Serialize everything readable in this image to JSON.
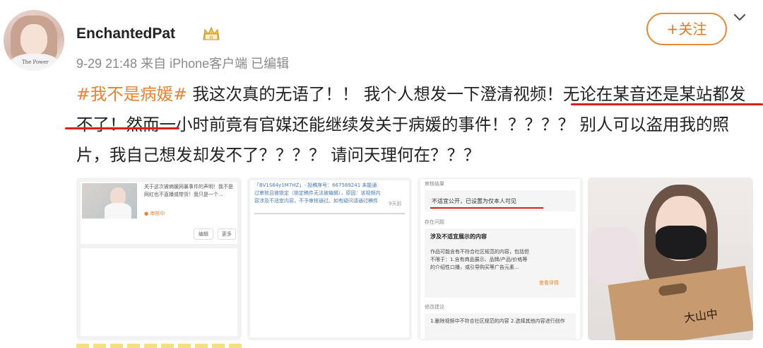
{
  "author": {
    "name": "EnchantedPat",
    "meta": "9-29 21:48 来自 iPhone客户端 已编辑",
    "follow_label": "+关注"
  },
  "post": {
    "hashtag": "#我不是病媛#",
    "text": " 我这次真的无语了！！ 我个人想发一下澄清视频！无论在某音还是某站都发不了！然而一小时前竟有官媒还能继续发关于病媛的事件！？？？？ 别人可以盗用我的照片，我自己想发却发不了？？？？ 请问天理何在？？？"
  },
  "image1": {
    "caption": "关于这次被病媛网暴事件的声明！我不是网红也不直播或带货！我只是一个...",
    "status": "审核中",
    "btn_edit": "编辑",
    "btn_more": "更多",
    "avatar_text": "The Power"
  },
  "image2": {
    "text": "「BV1S64y1M7HZ」- 投稿序号：667589241 未能通过审核且被锁定（锁定稿件无法被编辑），原因：该视频内容涉及不适宜内容，不予审核通过。如有疑问请通过稿件申诉进行反馈。",
    "time": "9天前"
  },
  "image3": {
    "result_header": "审核结果",
    "result": "不适宜公开，已设置为仅本人可见",
    "issue_header": "存在问题",
    "issue_title": "涉及不适宜展示的内容",
    "issue_body": "作品可能含有不符合社区规范的内容，包括但不限于：1.含有商品展示、品牌/产品/价格等的介绍性口播，或引导购买等广告元素...",
    "view_detail": "查看详情",
    "suggest_header": "修改建议",
    "suggest_body": "1.删除视频中不符合社区规范的内容 2.选择其他内容进行创作"
  },
  "image4": {
    "bag_text": "大山中"
  },
  "colors": {
    "accent": "#e8832e",
    "underline": "#d72222",
    "meta_gray": "#8a8a8a"
  }
}
